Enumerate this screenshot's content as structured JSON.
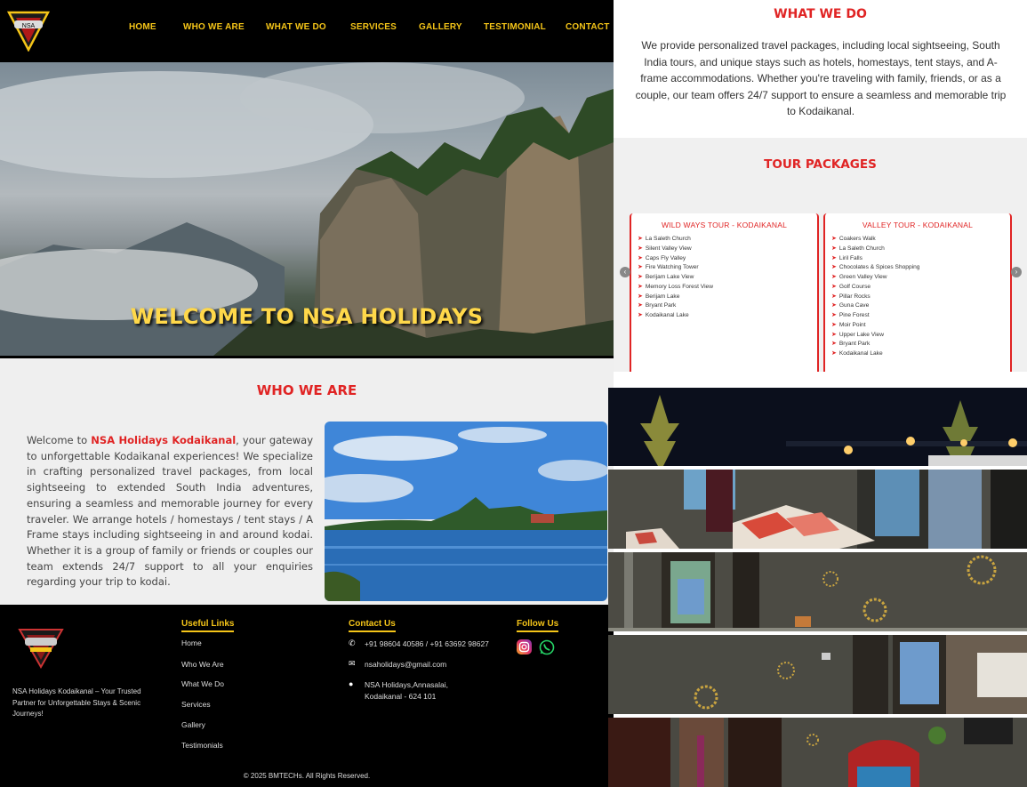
{
  "nav": {
    "logo_text": "NSA",
    "items": [
      "HOME",
      "WHO WE ARE",
      "WHAT WE DO",
      "SERVICES",
      "GALLERY",
      "TESTIMONIAL",
      "CONTACT"
    ]
  },
  "hero": {
    "title": "WELCOME TO NSA HOLIDAYS"
  },
  "who": {
    "title": "WHO WE ARE",
    "intro": "Welcome to ",
    "brand": "NSA Holidays Kodaikanal",
    "body": ", your gateway to unforgettable Kodaikanal experiences! We specialize in crafting personalized travel packages, from local sightseeing to extended South India adventures, ensuring a seamless and memorable journey for every traveler. We arrange hotels / homestays / tent stays / A Frame stays including sightseeing in and around kodai. Whether it is a group of family or friends or couples our team extends 24/7 support to all your enquiries regarding your trip to kodai."
  },
  "footer": {
    "tagline": "NSA Holidays Kodaikanal – Your Trusted Partner for Unforgettable Stays & Scenic Journeys!",
    "useful_links_title": "Useful Links",
    "links": [
      "Home",
      "Who We Are",
      "What We Do",
      "Services",
      "Gallery",
      "Testimonials"
    ],
    "contact_title": "Contact Us",
    "phone": "+91 98604 40586 / +91 63692 98627",
    "email": "nsaholidays@gmail.com",
    "address_line1": "NSA Holidays,Annasalai,",
    "address_line2": "Kodaikanal - 624 101",
    "follow_title": "Follow Us",
    "copyright": "© 2025 BMTECHs. All Rights Reserved."
  },
  "what_we_do": {
    "title": "WHAT WE DO",
    "text": "We provide personalized travel packages, including local sightseeing, South India tours, and unique stays such as hotels, homestays, tent stays, and A-frame accommodations. Whether you're traveling with family, friends, or as a couple, our team offers 24/7 support to ensure a seamless and memorable trip to Kodaikanal."
  },
  "tour_packages": {
    "title": "TOUR PACKAGES",
    "cards": [
      {
        "title": "WILD WAYS TOUR - KODAIKANAL",
        "items": [
          "La Saleth Church",
          "Silent Valley View",
          "Caps Fly Valley",
          "Fire Watching Tower",
          "Berijam Lake View",
          "Memory Loss Forest View",
          "Berijam Lake",
          "Bryant Park",
          "Kodaikanal Lake"
        ]
      },
      {
        "title": "VALLEY TOUR - KODAIKANAL",
        "items": [
          "Coakers Walk",
          "La Saleth Church",
          "Liril Falls",
          "Chocolates & Spices Shopping",
          "Green Valley View",
          "Golf Course",
          "Pillar Rocks",
          "Guna Cave",
          "Pine Forest",
          "Moir Point",
          "Upper Lake View",
          "Bryant Park",
          "Kodaikanal Lake"
        ]
      }
    ]
  },
  "colors": {
    "accent": "#e02424",
    "nav_text": "#f5c518"
  }
}
